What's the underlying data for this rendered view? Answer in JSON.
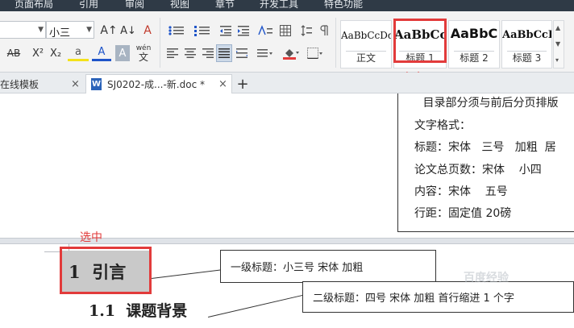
{
  "menubar": {
    "items": [
      "页面布局",
      "引用",
      "审阅",
      "视图",
      "章节",
      "开发工具",
      "特色功能"
    ]
  },
  "ribbon": {
    "font_size_value": "小三",
    "icons": {
      "grow_font": "A↑",
      "shrink_font": "A↓",
      "clear_format": "A",
      "strikethrough": "AB",
      "superscript": "X²",
      "subscript": "X₂",
      "highlight": "a",
      "font_color": "A",
      "char_shading": "A",
      "phonetic_top": "wén",
      "phonetic_bottom": "文"
    },
    "styles": [
      {
        "sample": "AaBbCcDd",
        "caption": "正文"
      },
      {
        "sample": "AaBbCc",
        "caption": "标题 1"
      },
      {
        "sample": "AaBbC",
        "caption": "标题 2"
      },
      {
        "sample": "AaBbCcI",
        "caption": "标题 3"
      }
    ]
  },
  "tabs": {
    "template_tab": "在线模板",
    "doc_tab": "SJ0202-成...-新.doc *",
    "doc_icon": "W",
    "new_tab": "+",
    "close": "×"
  },
  "annotations": {
    "click_label": "点击",
    "select_label": "选中"
  },
  "document": {
    "text_box_lines": [
      " 目录部分须与前后分页排版",
      "文字格式：",
      "标题：宋体   三号   加粗  居",
      "论文总页数：宋体    小四",
      "内容：宋体    五号",
      "行距：固定值 20磅"
    ],
    "heading1": "1  引言",
    "heading2": "1.1  课题背景",
    "callout1": "一级标题：小三号  宋体  加粗",
    "callout2": "二级标题：四号  宋体  加粗  首行缩进 1 个字"
  },
  "watermark": "百度经验"
}
